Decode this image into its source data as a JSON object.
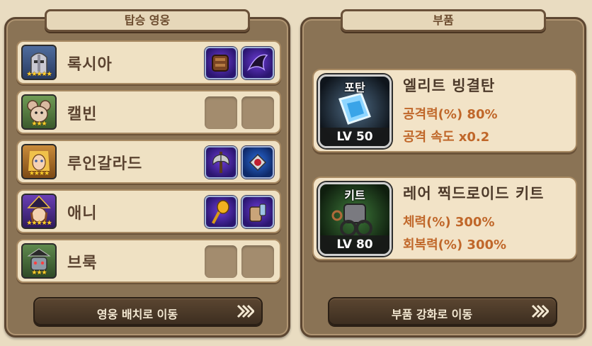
{
  "left_panel": {
    "title": "탑승 영웅",
    "heroes": [
      {
        "name": "록시아",
        "stars": "★★★★★",
        "slot1": "filled",
        "slot2": "filled"
      },
      {
        "name": "캘빈",
        "stars": "★★★",
        "slot1": "empty",
        "slot2": "empty"
      },
      {
        "name": "루인갈라드",
        "stars": "★★★★",
        "slot1": "filled",
        "slot2": "filled"
      },
      {
        "name": "애니",
        "stars": "★★★★★",
        "slot1": "filled",
        "slot2": "filled"
      },
      {
        "name": "브룩",
        "stars": "★★★",
        "slot1": "empty",
        "slot2": "empty"
      }
    ],
    "button_label": "영웅 배치로 이동"
  },
  "right_panel": {
    "title": "부품",
    "parts": [
      {
        "type": "포탄",
        "level": "LV 50",
        "name": "엘리트 빙결탄",
        "stat1": "공격력(%) 80%",
        "stat2": "공격 속도 x0.2"
      },
      {
        "type": "키트",
        "level": "LV 80",
        "name": "레어 찍드로이드 키트",
        "stat1": "체력(%) 300%",
        "stat2": "회복력(%) 300%"
      }
    ],
    "button_label": "부품 강화로 이동"
  },
  "colors": {
    "panel_bg": "#8a7355",
    "card_bg": "#efe1c3",
    "stat_text": "#c0672a",
    "slot_purple": "#4a2aa0"
  }
}
